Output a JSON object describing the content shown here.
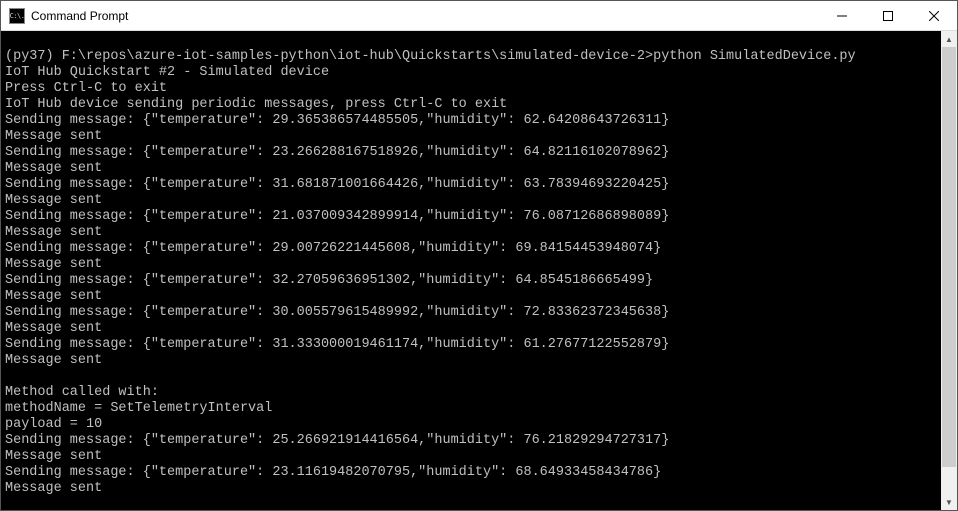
{
  "window": {
    "title": "Command Prompt",
    "icon_text": "C:\\."
  },
  "prompt": {
    "env": "(py37)",
    "cwd": "F:\\repos\\azure-iot-samples-python\\iot-hub\\Quickstarts\\simulated-device-2",
    "cmd": "python SimulatedDevice.py"
  },
  "header_lines": [
    "IoT Hub Quickstart #2 - Simulated device",
    "Press Ctrl-C to exit",
    "IoT Hub device sending periodic messages, press Ctrl-C to exit"
  ],
  "messages": [
    {
      "temperature": 29.365386574485505,
      "humidity": 62.64208643726311
    },
    {
      "temperature": 23.266288167518926,
      "humidity": 64.82116102078962
    },
    {
      "temperature": 31.681871001664426,
      "humidity": 63.78394693220425
    },
    {
      "temperature": 21.037009342899914,
      "humidity": 76.08712686898089
    },
    {
      "temperature": 29.00726221445608,
      "humidity": 69.84154453948074
    },
    {
      "temperature": 32.27059636951302,
      "humidity": 64.8545186665499
    },
    {
      "temperature": 30.005579615489992,
      "humidity": 72.83362372345638
    },
    {
      "temperature": 31.333000019461174,
      "humidity": 61.27677122552879
    }
  ],
  "sent_label": "Message sent",
  "sending_label": "Sending message:",
  "method_block": {
    "title": "Method called with:",
    "method_name_label": "methodName = ",
    "method_name": "SetTelemetryInterval",
    "payload_label": "payload = ",
    "payload": 10
  },
  "messages_after": [
    {
      "temperature": 25.266921914416564,
      "humidity": 76.21829294727317
    },
    {
      "temperature": 23.11619482070795,
      "humidity": 68.64933458434786
    }
  ]
}
